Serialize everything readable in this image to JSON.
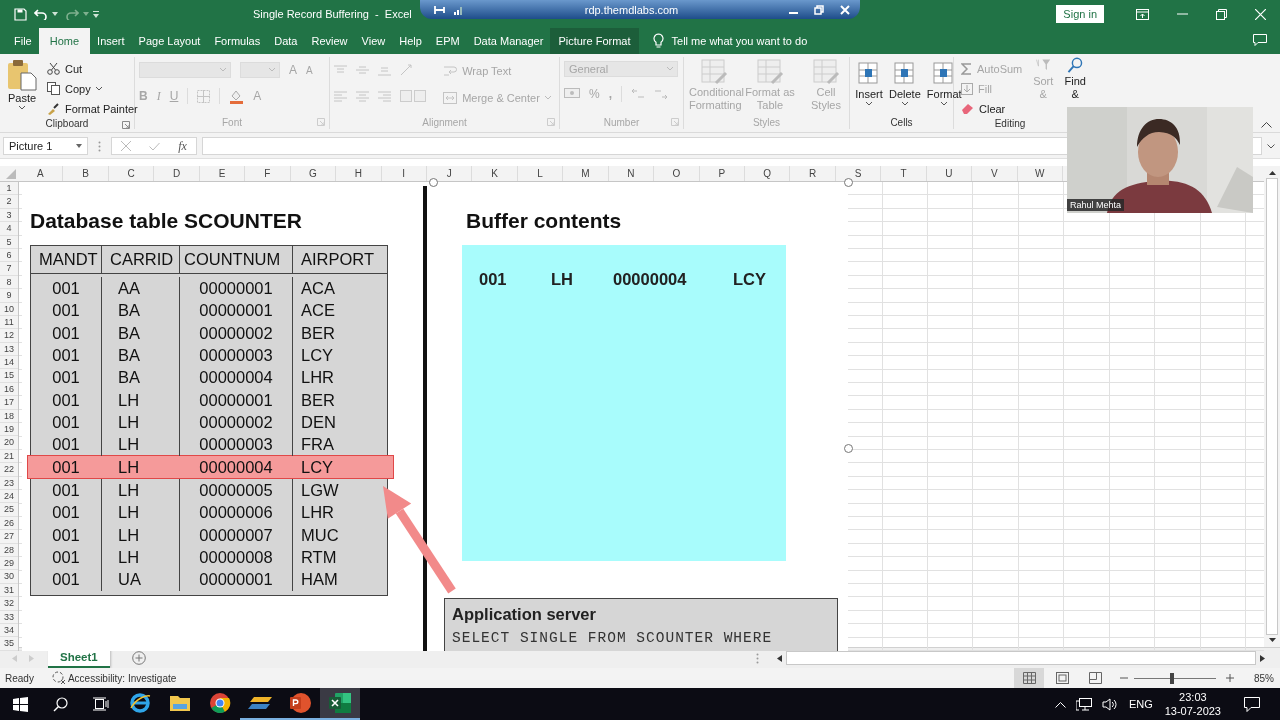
{
  "title_bar": {
    "title": "Single Record Buffering  -  Excel",
    "sign_in": "Sign in"
  },
  "remote_session_bar": {
    "host": "rdp.themdlabs.com"
  },
  "ribbon_tabs": [
    {
      "label": "File",
      "selected": false,
      "contextual": false
    },
    {
      "label": "Home",
      "selected": true,
      "contextual": false
    },
    {
      "label": "Insert",
      "selected": false,
      "contextual": false
    },
    {
      "label": "Page Layout",
      "selected": false,
      "contextual": false
    },
    {
      "label": "Formulas",
      "selected": false,
      "contextual": false
    },
    {
      "label": "Data",
      "selected": false,
      "contextual": false
    },
    {
      "label": "Review",
      "selected": false,
      "contextual": false
    },
    {
      "label": "View",
      "selected": false,
      "contextual": false
    },
    {
      "label": "Help",
      "selected": false,
      "contextual": false
    },
    {
      "label": "EPM",
      "selected": false,
      "contextual": false
    },
    {
      "label": "Data Manager",
      "selected": false,
      "contextual": false
    },
    {
      "label": "Picture Format",
      "selected": false,
      "contextual": true
    }
  ],
  "tell_me": "Tell me what you want to do",
  "ribbon": {
    "clipboard": {
      "label": "Clipboard",
      "paste": "Paste",
      "cut": "Cut",
      "copy": "Copy",
      "format_painter": "Format Painter"
    },
    "font": {
      "label": "Font",
      "disabled": true,
      "grow_font": "A",
      "shrink_font": "A",
      "bold": "B",
      "italic": "I",
      "underline": "U",
      "font_color": "A"
    },
    "alignment": {
      "label": "Alignment",
      "disabled": true,
      "wrap_text": "Wrap Text",
      "merge_center": "Merge & Center"
    },
    "number": {
      "label": "Number",
      "disabled": true,
      "format": "General",
      "percent": "%",
      "comma": ","
    },
    "styles": {
      "label": "Styles",
      "disabled": true,
      "buttons": [
        "Conditional Formatting",
        "Format as Table",
        "Cell Styles"
      ]
    },
    "cells": {
      "label": "Cells",
      "buttons": [
        {
          "label": "Insert",
          "disabled": false
        },
        {
          "label": "Delete",
          "disabled": false
        },
        {
          "label": "Format",
          "disabled": false
        }
      ]
    },
    "editing": {
      "label": "Editing",
      "autosum": {
        "label": "AutoSum",
        "disabled": true
      },
      "fill": {
        "label": "Fill",
        "disabled": true
      },
      "clear": {
        "label": "Clear",
        "disabled": false
      },
      "sort_filter": {
        "label": "Sort &",
        "disabled": true
      },
      "find_select": {
        "label": "Find &",
        "disabled": false
      }
    }
  },
  "formula_bar": {
    "name_box": "Picture 1",
    "function_label": "fx"
  },
  "columns": [
    "A",
    "B",
    "C",
    "D",
    "E",
    "F",
    "G",
    "H",
    "I",
    "J",
    "K",
    "L",
    "M",
    "N",
    "O",
    "P",
    "Q",
    "R",
    "S",
    "T",
    "U",
    "V",
    "W"
  ],
  "rows": [
    "1",
    "2",
    "3",
    "4",
    "5",
    "6",
    "7",
    "8",
    "9",
    "10",
    "11",
    "12",
    "13",
    "14",
    "15",
    "16",
    "17",
    "18",
    "19",
    "20",
    "21",
    "22",
    "23",
    "24",
    "25",
    "26",
    "27",
    "28",
    "29",
    "30",
    "31",
    "32",
    "33",
    "34",
    "35"
  ],
  "slide": {
    "table_title": "Database table SCOUNTER",
    "columns": [
      "MANDT",
      "CARRID",
      "COUNTNUM",
      "AIRPORT"
    ],
    "rows": [
      {
        "cells": [
          "001",
          "AA",
          "00000001",
          "ACA"
        ],
        "highlighted": false
      },
      {
        "cells": [
          "001",
          "BA",
          "00000001",
          "ACE"
        ],
        "highlighted": false
      },
      {
        "cells": [
          "001",
          "BA",
          "00000002",
          "BER"
        ],
        "highlighted": false
      },
      {
        "cells": [
          "001",
          "BA",
          "00000003",
          "LCY"
        ],
        "highlighted": false
      },
      {
        "cells": [
          "001",
          "BA",
          "00000004",
          "LHR"
        ],
        "highlighted": false
      },
      {
        "cells": [
          "001",
          "LH",
          "00000001",
          "BER"
        ],
        "highlighted": false
      },
      {
        "cells": [
          "001",
          "LH",
          "00000002",
          "DEN"
        ],
        "highlighted": false
      },
      {
        "cells": [
          "001",
          "LH",
          "00000003",
          "FRA"
        ],
        "highlighted": false
      },
      {
        "cells": [
          "001",
          "LH",
          "00000004",
          "LCY"
        ],
        "highlighted": true
      },
      {
        "cells": [
          "001",
          "LH",
          "00000005",
          "LGW"
        ],
        "highlighted": false
      },
      {
        "cells": [
          "001",
          "LH",
          "00000006",
          "LHR"
        ],
        "highlighted": false
      },
      {
        "cells": [
          "001",
          "LH",
          "00000007",
          "MUC"
        ],
        "highlighted": false
      },
      {
        "cells": [
          "001",
          "LH",
          "00000008",
          "RTM"
        ],
        "highlighted": false
      },
      {
        "cells": [
          "001",
          "UA",
          "00000001",
          "HAM"
        ],
        "highlighted": false
      }
    ],
    "buffer_title": "Buffer contents",
    "buffer_rows": [
      [
        "001",
        "LH",
        "00000004",
        "LCY"
      ]
    ],
    "server_title": "Application server",
    "statement": "SELECT SINGLE FROM SCOUNTER WHERE"
  },
  "video_tile": {
    "name": "Rahul Mehta"
  },
  "sheet_tabs": [
    {
      "label": "Sheet1",
      "selected": true
    }
  ],
  "status_bar": {
    "mode": "Ready",
    "accessibility": "Accessibility: Investigate",
    "views": [
      {
        "selected": true
      },
      {
        "selected": false
      },
      {
        "selected": false
      }
    ],
    "zoom": {
      "level": 0.46,
      "reading": "85%"
    }
  },
  "taskbar": {
    "apps": [
      {
        "running": false,
        "selected": false
      },
      {
        "running": false,
        "selected": false
      },
      {
        "running": false,
        "selected": false
      },
      {
        "running": true,
        "selected": false
      },
      {
        "running": true,
        "selected": false
      },
      {
        "running": true,
        "selected": true
      }
    ],
    "language": "ENG",
    "time": "23:03",
    "date": "13-07-2023"
  }
}
